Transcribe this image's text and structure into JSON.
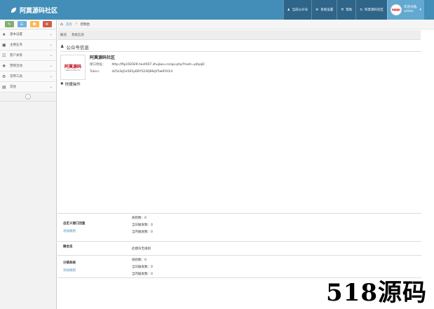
{
  "header": {
    "brand": "阿莫源码社区",
    "nav": [
      "当前公众号",
      "系统设置",
      "帮助",
      "阿莫源码社区"
    ],
    "user_greeting": "欢迎光临,",
    "user_name": "admin",
    "avatar_text": "阿莫源码"
  },
  "sidebar": {
    "shortcuts": [
      {
        "icon": "pencil-icon",
        "color": "#82af6f"
      },
      {
        "icon": "list-icon",
        "color": "#6fb3e0"
      },
      {
        "icon": "group-icon",
        "color": "#ffb752"
      },
      {
        "icon": "cogs-icon",
        "color": "#d15b47"
      }
    ],
    "items": [
      {
        "label": "基本设置",
        "icon": "star-icon"
      },
      {
        "label": "主要业务",
        "icon": "briefcase-icon"
      },
      {
        "label": "客户关系",
        "icon": "sitemap-icon"
      },
      {
        "label": "营销活动",
        "icon": "gift-icon"
      },
      {
        "label": "常用工具",
        "icon": "cog-icon"
      },
      {
        "label": "其他",
        "icon": "folder-icon"
      }
    ]
  },
  "breadcrumb": {
    "home": "首页",
    "current": "控制台"
  },
  "tabs": [
    "概况",
    "系统信息"
  ],
  "account": {
    "section_title": "公众号信息",
    "logo_text": "阿莫源码",
    "logo_url": "www.2cn3w.com",
    "name": "阿莫源码社区",
    "api_label": "接口地址：",
    "api_value": "http://ftp192029.host507.zhujiwu.cn/api.php?hash=p6yqD",
    "token_label": "Token：",
    "token_value": "d25z3q5x565y66Y523Q66qY5w6YU1d",
    "quick_label": "快捷操作"
  },
  "stats": [
    {
      "title": "自定义接口回复",
      "link": "添加规则",
      "lines": [
        "规则数：0",
        "当日触发数：0",
        "当月触发数：0"
      ]
    },
    {
      "title": "微会员",
      "link": "",
      "lines": [
        "此模块无规则"
      ]
    },
    {
      "title": "分销系统",
      "link": "添加规则",
      "lines": [
        "规则数：0",
        "当日触发数：0",
        "当月触发数：0"
      ]
    }
  ],
  "watermark": "518源码"
}
